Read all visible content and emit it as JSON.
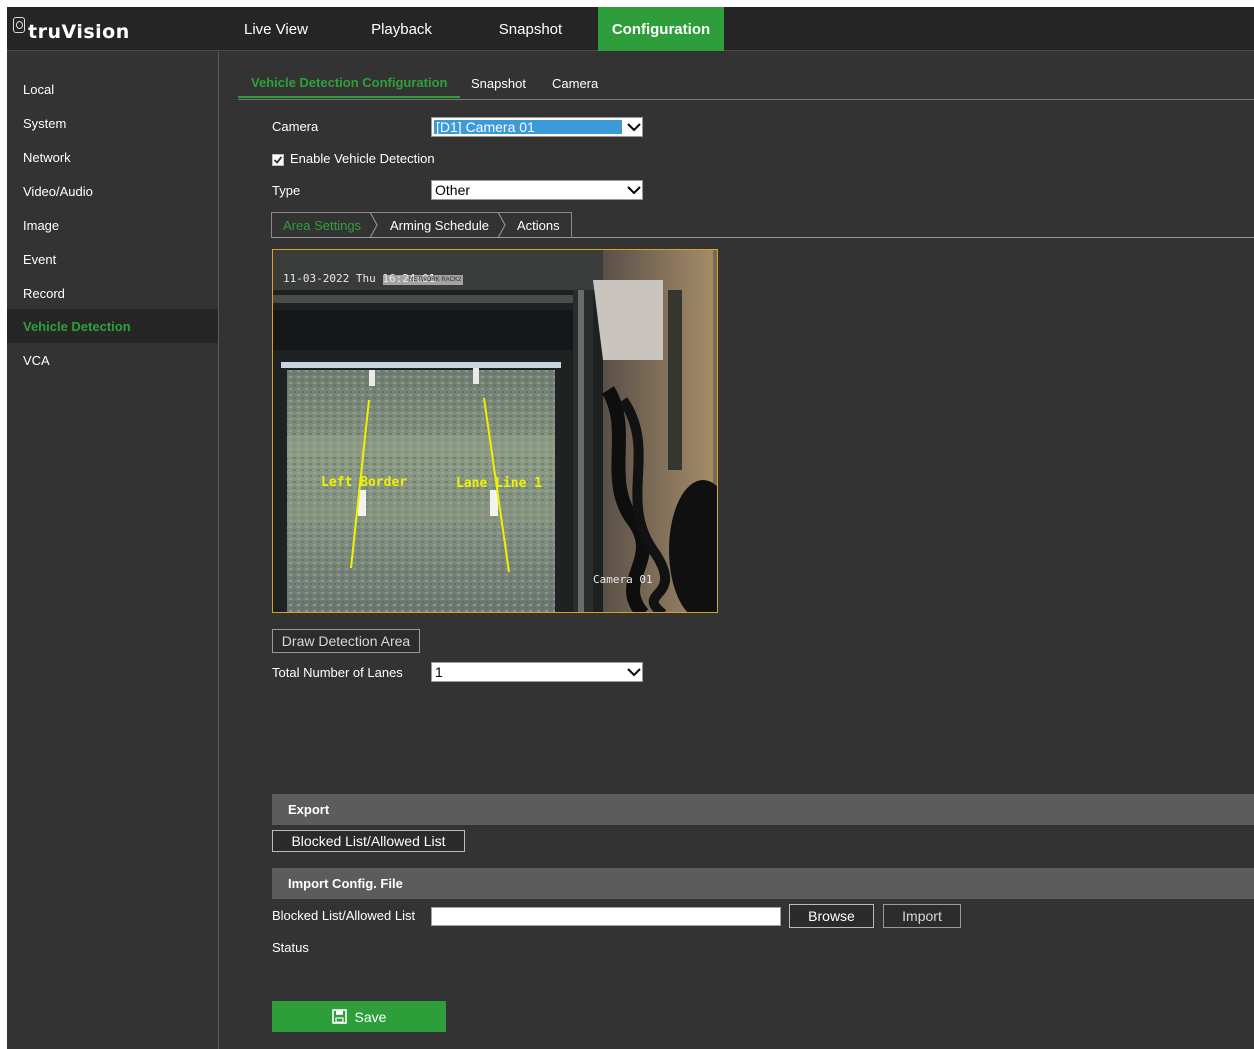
{
  "app": {
    "logo_text": "truVision"
  },
  "nav": {
    "items": [
      "Live View",
      "Playback",
      "Snapshot",
      "Configuration"
    ],
    "active": "Configuration"
  },
  "sidebar": {
    "items": [
      "Local",
      "System",
      "Network",
      "Video/Audio",
      "Image",
      "Event",
      "Record",
      "Vehicle Detection",
      "VCA"
    ],
    "active": "Vehicle Detection"
  },
  "subtabs": {
    "items": [
      "Vehicle Detection Configuration",
      "Snapshot",
      "Camera"
    ],
    "active": "Vehicle Detection Configuration"
  },
  "form": {
    "camera_label": "Camera",
    "camera_value": "[D1] Camera 01",
    "enable_label": "Enable Vehicle Detection",
    "enable_checked": true,
    "type_label": "Type",
    "type_value": "Other"
  },
  "steps": {
    "items": [
      "Area Settings",
      "Arming Schedule",
      "Actions"
    ],
    "active": "Area Settings"
  },
  "video": {
    "osd_datetime": "11-03-2022 Thu 16:24:01",
    "osd_title": "NETWORK RACK2",
    "left_border_label": "Left Border",
    "lane_line_label": "Lane Line 1",
    "camera_name": "Camera 01"
  },
  "area": {
    "draw_button": "Draw Detection Area",
    "lanes_label": "Total Number of Lanes",
    "lanes_value": "1"
  },
  "export": {
    "title": "Export",
    "button": "Blocked List/Allowed List"
  },
  "import": {
    "title": "Import Config. File",
    "field_label": "Blocked List/Allowed List",
    "field_value": "",
    "browse_button": "Browse",
    "import_button": "Import",
    "status_label": "Status"
  },
  "save_button": "Save",
  "colors": {
    "accent": "#2e9e3b",
    "background": "#333333",
    "topbar": "#252525",
    "section_bar": "#5c5c5c",
    "overlay_line": "#f0f000"
  }
}
